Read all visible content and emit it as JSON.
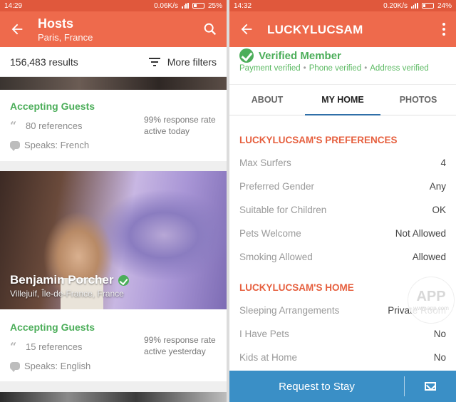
{
  "left": {
    "status": {
      "time": "14:29",
      "speed": "0.06K/s",
      "battery": "25%",
      "battery_level": 0.25
    },
    "header": {
      "title": "Hosts",
      "subtitle": "Paris, France"
    },
    "results": {
      "count": "156,483 results",
      "filters_label": "More filters"
    },
    "hosts": [
      {
        "name": "",
        "location": "",
        "accepting": "Accepting Guests",
        "references": "80 references",
        "speaks": "Speaks: French",
        "response_rate": "99% response rate",
        "activity": "active today"
      },
      {
        "name": "Benjamin Porcher",
        "location": "Villejuif, Île-de-France, France",
        "accepting": "Accepting Guests",
        "references": "15 references",
        "speaks": "Speaks: English",
        "response_rate": "99% response rate",
        "activity": "active yesterday"
      }
    ]
  },
  "right": {
    "status": {
      "time": "14:32",
      "speed": "0.20K/s",
      "battery": "24%",
      "battery_level": 0.24
    },
    "header": {
      "title": "LUCKYLUCSAM"
    },
    "verified": {
      "label": "Verified Member",
      "items": [
        "Payment verified",
        "Phone verified",
        "Address verified"
      ]
    },
    "tabs": [
      "ABOUT",
      "MY HOME",
      "PHOTOS"
    ],
    "active_tab": "MY HOME",
    "preferences": {
      "heading": "LUCKYLUCSAM'S PREFERENCES",
      "rows": [
        {
          "k": "Max Surfers",
          "v": "4"
        },
        {
          "k": "Preferred Gender",
          "v": "Any"
        },
        {
          "k": "Suitable for Children",
          "v": "OK"
        },
        {
          "k": "Pets Welcome",
          "v": "Not Allowed"
        },
        {
          "k": "Smoking Allowed",
          "v": "Allowed"
        }
      ]
    },
    "home": {
      "heading": "LUCKYLUCSAM'S HOME",
      "rows": [
        {
          "k": "Sleeping Arrangements",
          "v": "Private Room"
        },
        {
          "k": "I Have Pets",
          "v": "No"
        },
        {
          "k": "Kids at Home",
          "v": "No"
        }
      ]
    },
    "watermark": {
      "main": "APP",
      "sub": "www.app.com"
    },
    "cta": {
      "label": "Request to Stay"
    }
  },
  "colors": {
    "brand": "#ee6a4c",
    "status_bar": "#e0583c",
    "accepting_green": "#4cae5a",
    "section_orange": "#e6603f",
    "cta_blue": "#3a8fc6",
    "tab_underline": "#2f6fa8"
  }
}
